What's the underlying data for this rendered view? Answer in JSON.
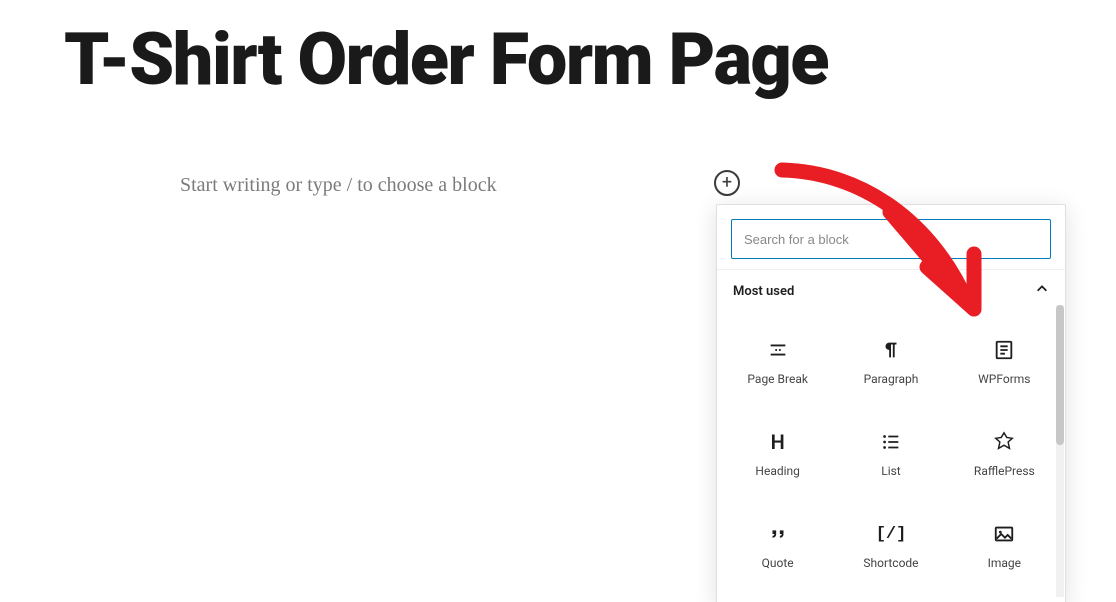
{
  "page": {
    "title": "T-Shirt Order Form Page",
    "placeholder": "Start writing or type / to choose a block"
  },
  "inserter": {
    "search_placeholder": "Search for a block",
    "section_title": "Most used",
    "blocks": [
      {
        "label": "Page Break",
        "icon": "page-break"
      },
      {
        "label": "Paragraph",
        "icon": "paragraph"
      },
      {
        "label": "WPForms",
        "icon": "wpforms"
      },
      {
        "label": "Heading",
        "icon": "heading"
      },
      {
        "label": "List",
        "icon": "list"
      },
      {
        "label": "RafflePress",
        "icon": "rafflepress"
      },
      {
        "label": "Quote",
        "icon": "quote"
      },
      {
        "label": "Shortcode",
        "icon": "shortcode"
      },
      {
        "label": "Image",
        "icon": "image"
      }
    ]
  },
  "annotation": {
    "arrow_color": "#e91e24"
  }
}
